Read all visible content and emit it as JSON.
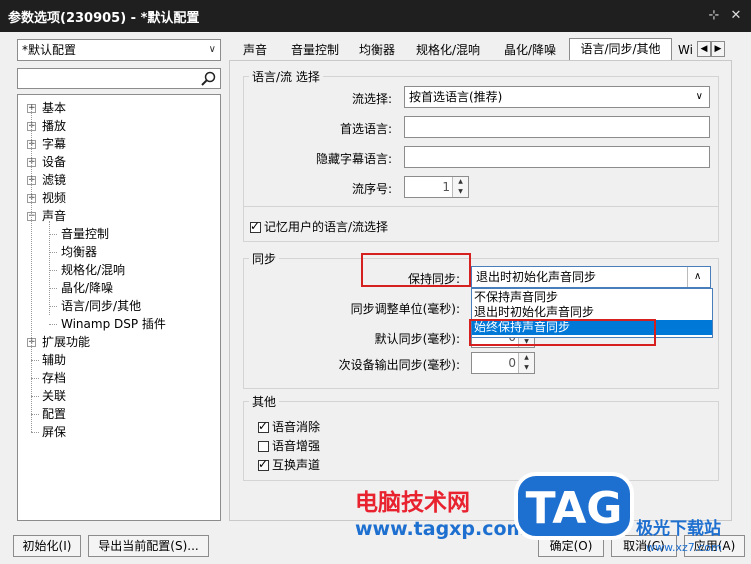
{
  "window": {
    "title": "参数选项(230905) - *默认配置",
    "pin_glyph": "⊹",
    "close_glyph": "✕"
  },
  "left": {
    "profile_combo": "*默认配置",
    "search_value": "",
    "tree": [
      {
        "label": "基本",
        "expander": "+"
      },
      {
        "label": "播放",
        "expander": "+"
      },
      {
        "label": "字幕",
        "expander": "+"
      },
      {
        "label": "设备",
        "expander": "+"
      },
      {
        "label": "滤镜",
        "expander": "+"
      },
      {
        "label": "视频",
        "expander": "+"
      },
      {
        "label": "声音",
        "expander": "−"
      },
      {
        "label": "音量控制"
      },
      {
        "label": "均衡器"
      },
      {
        "label": "规格化/混响"
      },
      {
        "label": "晶化/降噪"
      },
      {
        "label": "语言/同步/其他"
      },
      {
        "label": "Winamp DSP 插件"
      },
      {
        "label": "扩展功能",
        "expander": "+"
      },
      {
        "label": "辅助"
      },
      {
        "label": "存档"
      },
      {
        "label": "关联"
      },
      {
        "label": "配置"
      },
      {
        "label": "屏保"
      }
    ]
  },
  "tabs": [
    {
      "label": "声音"
    },
    {
      "label": "音量控制"
    },
    {
      "label": "均衡器"
    },
    {
      "label": "规格化/混响"
    },
    {
      "label": "晶化/降噪"
    },
    {
      "label": "语言/同步/其他",
      "active": true
    },
    {
      "label": "Wi"
    }
  ],
  "lang_group": {
    "title": "语言/流 选择",
    "stream_select_label": "流选择:",
    "stream_select_value": "按首选语言(推荐)",
    "preferred_lang_label": "首选语言:",
    "preferred_lang_value": "",
    "hidden_sub_label": "隐藏字幕语言:",
    "hidden_sub_value": "",
    "stream_no_label": "流序号:",
    "stream_no_value": "1",
    "remember_label": "记忆用户的语言/流选择",
    "remember_checked": true
  },
  "sync_group": {
    "title": "同步",
    "keep_sync_label": "保持同步:",
    "keep_sync_value": "退出时初始化声音同步",
    "adjust_unit_label": "同步调整单位(毫秒):",
    "default_sync_label": "默认同步(毫秒):",
    "default_sync_value": "0",
    "secondary_sync_label": "次设备输出同步(毫秒):",
    "secondary_sync_value": "0",
    "dropdown_options": [
      "不保持声音同步",
      "退出时初始化声音同步",
      "始终保持声音同步"
    ],
    "dropdown_selected_index": 2
  },
  "other_group": {
    "title": "其他",
    "options": [
      {
        "label": "语音消除",
        "checked": true
      },
      {
        "label": "语音增强",
        "checked": false
      },
      {
        "label": "互换声道",
        "checked": true
      }
    ]
  },
  "bottom": {
    "init_button": "初始化(I)",
    "export_button": "导出当前配置(S)...",
    "ok_button": "确定(O)",
    "cancel_button": "取消(C)",
    "apply_button": "应用(A)"
  },
  "watermark": {
    "site_name": "电脑技术网",
    "url": "www.tagxp.com",
    "logo_text": "TAG",
    "sub_text": "极光下载站",
    "sub_url": "www.xz7.com"
  },
  "colors": {
    "accent": "#0078d7",
    "highlight_box": "#d61f1f",
    "titlebar": "#1f1f1f"
  }
}
